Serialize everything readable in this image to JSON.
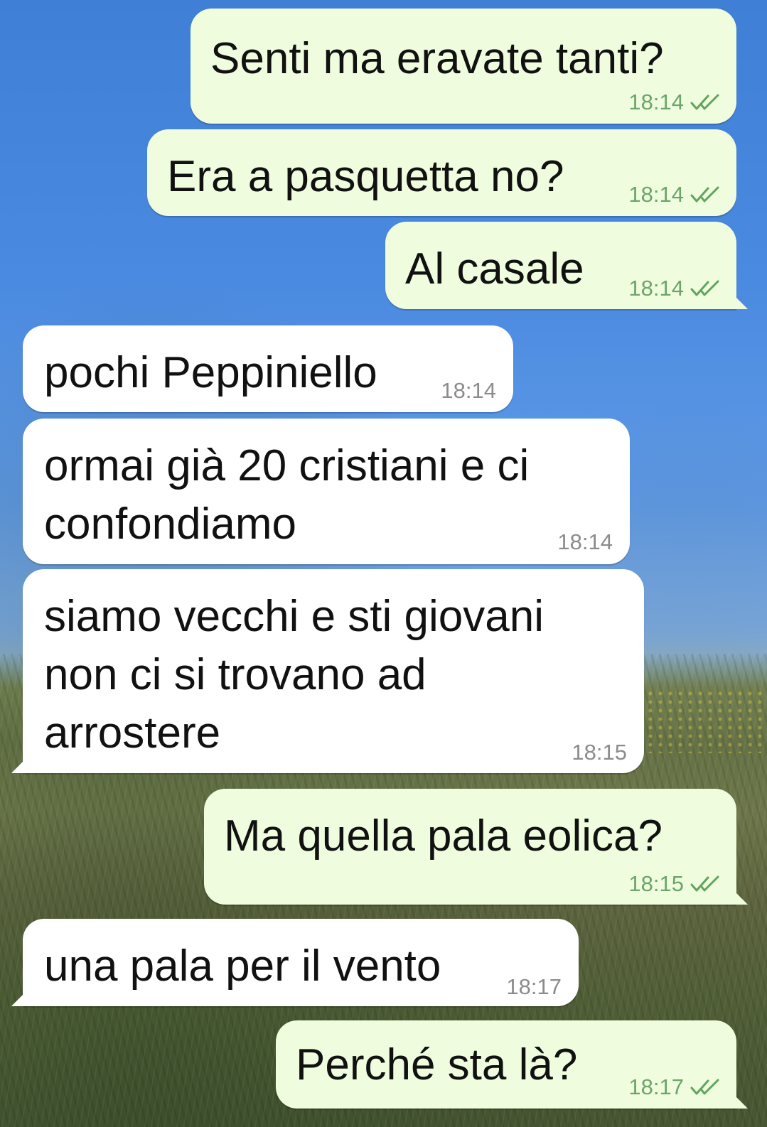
{
  "theme": {
    "outgoing_bubble_color": "#effdde",
    "incoming_bubble_color": "#ffffff",
    "outgoing_time_color": "#6ba56a",
    "incoming_time_color": "#8c8c8c",
    "read_check_icon": "double-check-icon"
  },
  "messages": [
    {
      "direction": "outgoing",
      "lines": [
        "Senti ma eravate tanti?"
      ],
      "time": "18:14",
      "status": "read"
    },
    {
      "direction": "outgoing",
      "lines": [
        "Era a pasquetta no?"
      ],
      "time": "18:14",
      "status": "read"
    },
    {
      "direction": "outgoing",
      "lines": [
        "Al casale"
      ],
      "time": "18:14",
      "status": "read"
    },
    {
      "direction": "incoming",
      "lines": [
        "pochi Peppiniello"
      ],
      "time": "18:14"
    },
    {
      "direction": "incoming",
      "lines": [
        "ormai già 20 cristiani e ci",
        "confondiamo"
      ],
      "time": "18:14"
    },
    {
      "direction": "incoming",
      "lines": [
        "siamo vecchi e sti giovani",
        "non ci si trovano ad",
        "arrostere"
      ],
      "time": "18:15"
    },
    {
      "direction": "outgoing",
      "lines": [
        "Ma quella pala eolica?"
      ],
      "time": "18:15",
      "status": "read"
    },
    {
      "direction": "incoming",
      "lines": [
        "una pala per il vento"
      ],
      "time": "18:17"
    },
    {
      "direction": "outgoing",
      "lines": [
        "Perché sta là?"
      ],
      "time": "18:17",
      "status": "read"
    }
  ]
}
